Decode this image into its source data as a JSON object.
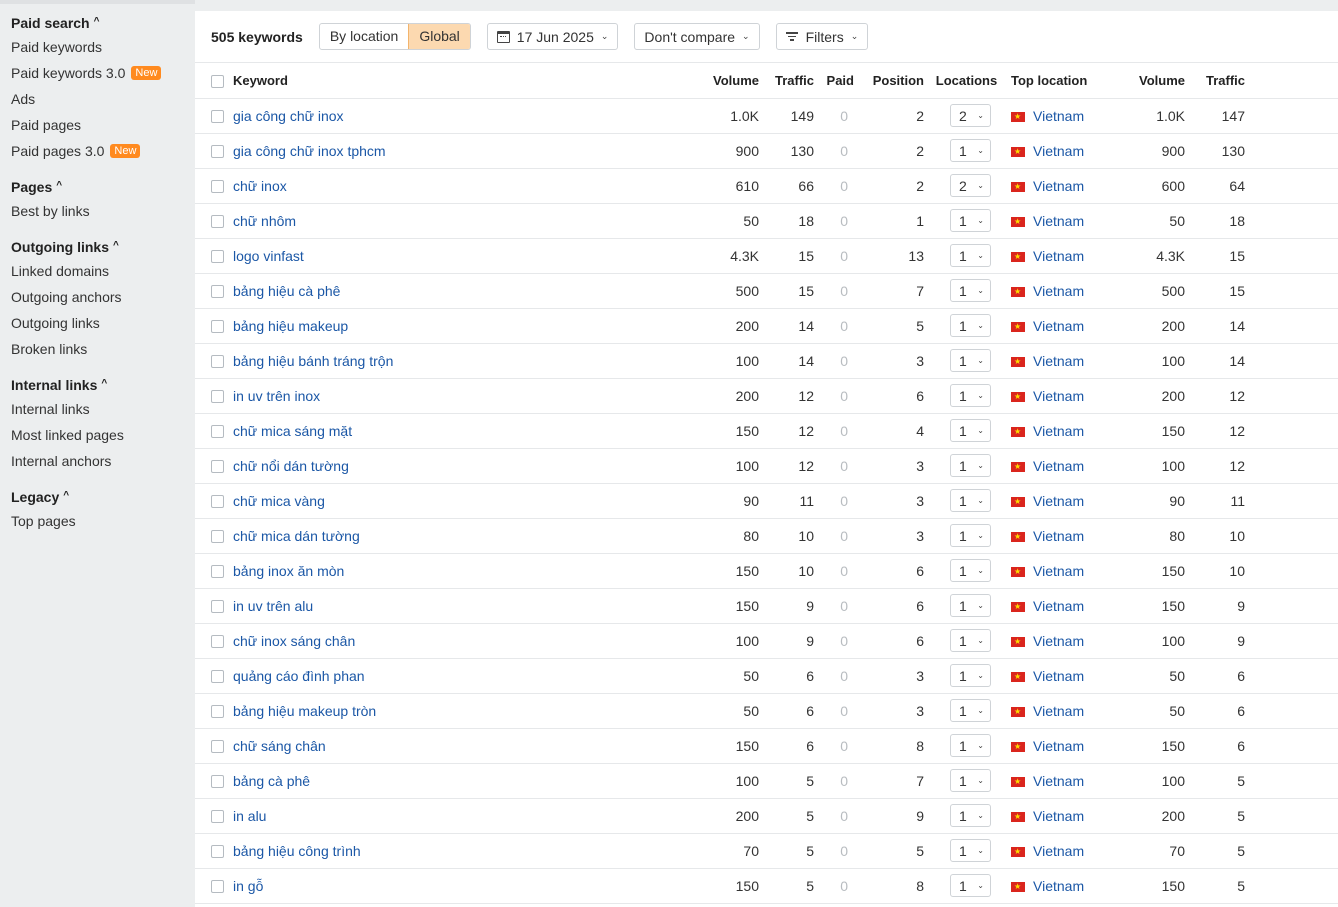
{
  "sidebar": {
    "sections": [
      {
        "heading": "Paid search",
        "items": [
          {
            "label": "Paid keywords",
            "badge": ""
          },
          {
            "label": "Paid keywords 3.0",
            "badge": "New"
          },
          {
            "label": "Ads",
            "badge": ""
          },
          {
            "label": "Paid pages",
            "badge": ""
          },
          {
            "label": "Paid pages 3.0",
            "badge": "New"
          }
        ]
      },
      {
        "heading": "Pages",
        "items": [
          {
            "label": "Best by links",
            "badge": ""
          }
        ]
      },
      {
        "heading": "Outgoing links",
        "items": [
          {
            "label": "Linked domains",
            "badge": ""
          },
          {
            "label": "Outgoing anchors",
            "badge": ""
          },
          {
            "label": "Outgoing links",
            "badge": ""
          },
          {
            "label": "Broken links",
            "badge": ""
          }
        ]
      },
      {
        "heading": "Internal links",
        "items": [
          {
            "label": "Internal links",
            "badge": ""
          },
          {
            "label": "Most linked pages",
            "badge": ""
          },
          {
            "label": "Internal anchors",
            "badge": ""
          }
        ]
      },
      {
        "heading": "Legacy",
        "items": [
          {
            "label": "Top pages",
            "badge": ""
          }
        ]
      }
    ]
  },
  "toolbar": {
    "keyword_count": "505 keywords",
    "by_location": "By location",
    "global": "Global",
    "date": "17 Jun 2025",
    "compare": "Don't compare",
    "filters": "Filters"
  },
  "table": {
    "headers": {
      "keyword": "Keyword",
      "volume": "Volume",
      "traffic": "Traffic",
      "paid": "Paid",
      "position": "Position",
      "locations": "Locations",
      "top_location": "Top location",
      "top_volume": "Volume",
      "top_traffic": "Traffic"
    },
    "rows": [
      {
        "keyword": "gia công chữ inox",
        "volume": "1.0K",
        "traffic": "149",
        "paid": "0",
        "position": "2",
        "locations": "2",
        "country": "Vietnam",
        "top_volume": "1.0K",
        "top_traffic": "147"
      },
      {
        "keyword": "gia công chữ inox tphcm",
        "volume": "900",
        "traffic": "130",
        "paid": "0",
        "position": "2",
        "locations": "1",
        "country": "Vietnam",
        "top_volume": "900",
        "top_traffic": "130"
      },
      {
        "keyword": "chữ inox",
        "volume": "610",
        "traffic": "66",
        "paid": "0",
        "position": "2",
        "locations": "2",
        "country": "Vietnam",
        "top_volume": "600",
        "top_traffic": "64"
      },
      {
        "keyword": "chữ nhôm",
        "volume": "50",
        "traffic": "18",
        "paid": "0",
        "position": "1",
        "locations": "1",
        "country": "Vietnam",
        "top_volume": "50",
        "top_traffic": "18"
      },
      {
        "keyword": "logo vinfast",
        "volume": "4.3K",
        "traffic": "15",
        "paid": "0",
        "position": "13",
        "locations": "1",
        "country": "Vietnam",
        "top_volume": "4.3K",
        "top_traffic": "15"
      },
      {
        "keyword": "bảng hiệu cà phê",
        "volume": "500",
        "traffic": "15",
        "paid": "0",
        "position": "7",
        "locations": "1",
        "country": "Vietnam",
        "top_volume": "500",
        "top_traffic": "15"
      },
      {
        "keyword": "bảng hiệu makeup",
        "volume": "200",
        "traffic": "14",
        "paid": "0",
        "position": "5",
        "locations": "1",
        "country": "Vietnam",
        "top_volume": "200",
        "top_traffic": "14"
      },
      {
        "keyword": "bảng hiệu bánh tráng trộn",
        "volume": "100",
        "traffic": "14",
        "paid": "0",
        "position": "3",
        "locations": "1",
        "country": "Vietnam",
        "top_volume": "100",
        "top_traffic": "14"
      },
      {
        "keyword": "in uv trên inox",
        "volume": "200",
        "traffic": "12",
        "paid": "0",
        "position": "6",
        "locations": "1",
        "country": "Vietnam",
        "top_volume": "200",
        "top_traffic": "12"
      },
      {
        "keyword": "chữ mica sáng mặt",
        "volume": "150",
        "traffic": "12",
        "paid": "0",
        "position": "4",
        "locations": "1",
        "country": "Vietnam",
        "top_volume": "150",
        "top_traffic": "12"
      },
      {
        "keyword": "chữ nổi dán tường",
        "volume": "100",
        "traffic": "12",
        "paid": "0",
        "position": "3",
        "locations": "1",
        "country": "Vietnam",
        "top_volume": "100",
        "top_traffic": "12"
      },
      {
        "keyword": "chữ mica vàng",
        "volume": "90",
        "traffic": "11",
        "paid": "0",
        "position": "3",
        "locations": "1",
        "country": "Vietnam",
        "top_volume": "90",
        "top_traffic": "11"
      },
      {
        "keyword": "chữ mica dán tường",
        "volume": "80",
        "traffic": "10",
        "paid": "0",
        "position": "3",
        "locations": "1",
        "country": "Vietnam",
        "top_volume": "80",
        "top_traffic": "10"
      },
      {
        "keyword": "bảng inox ăn mòn",
        "volume": "150",
        "traffic": "10",
        "paid": "0",
        "position": "6",
        "locations": "1",
        "country": "Vietnam",
        "top_volume": "150",
        "top_traffic": "10"
      },
      {
        "keyword": "in uv trên alu",
        "volume": "150",
        "traffic": "9",
        "paid": "0",
        "position": "6",
        "locations": "1",
        "country": "Vietnam",
        "top_volume": "150",
        "top_traffic": "9"
      },
      {
        "keyword": "chữ inox sáng chân",
        "volume": "100",
        "traffic": "9",
        "paid": "0",
        "position": "6",
        "locations": "1",
        "country": "Vietnam",
        "top_volume": "100",
        "top_traffic": "9"
      },
      {
        "keyword": "quảng cáo đình phan",
        "volume": "50",
        "traffic": "6",
        "paid": "0",
        "position": "3",
        "locations": "1",
        "country": "Vietnam",
        "top_volume": "50",
        "top_traffic": "6"
      },
      {
        "keyword": "bảng hiệu makeup tròn",
        "volume": "50",
        "traffic": "6",
        "paid": "0",
        "position": "3",
        "locations": "1",
        "country": "Vietnam",
        "top_volume": "50",
        "top_traffic": "6"
      },
      {
        "keyword": "chữ sáng chân",
        "volume": "150",
        "traffic": "6",
        "paid": "0",
        "position": "8",
        "locations": "1",
        "country": "Vietnam",
        "top_volume": "150",
        "top_traffic": "6"
      },
      {
        "keyword": "bảng cà phê",
        "volume": "100",
        "traffic": "5",
        "paid": "0",
        "position": "7",
        "locations": "1",
        "country": "Vietnam",
        "top_volume": "100",
        "top_traffic": "5"
      },
      {
        "keyword": "in alu",
        "volume": "200",
        "traffic": "5",
        "paid": "0",
        "position": "9",
        "locations": "1",
        "country": "Vietnam",
        "top_volume": "200",
        "top_traffic": "5"
      },
      {
        "keyword": "bảng hiệu công trình",
        "volume": "70",
        "traffic": "5",
        "paid": "0",
        "position": "5",
        "locations": "1",
        "country": "Vietnam",
        "top_volume": "70",
        "top_traffic": "5"
      },
      {
        "keyword": "in gỗ",
        "volume": "150",
        "traffic": "5",
        "paid": "0",
        "position": "8",
        "locations": "1",
        "country": "Vietnam",
        "top_volume": "150",
        "top_traffic": "5"
      }
    ]
  }
}
